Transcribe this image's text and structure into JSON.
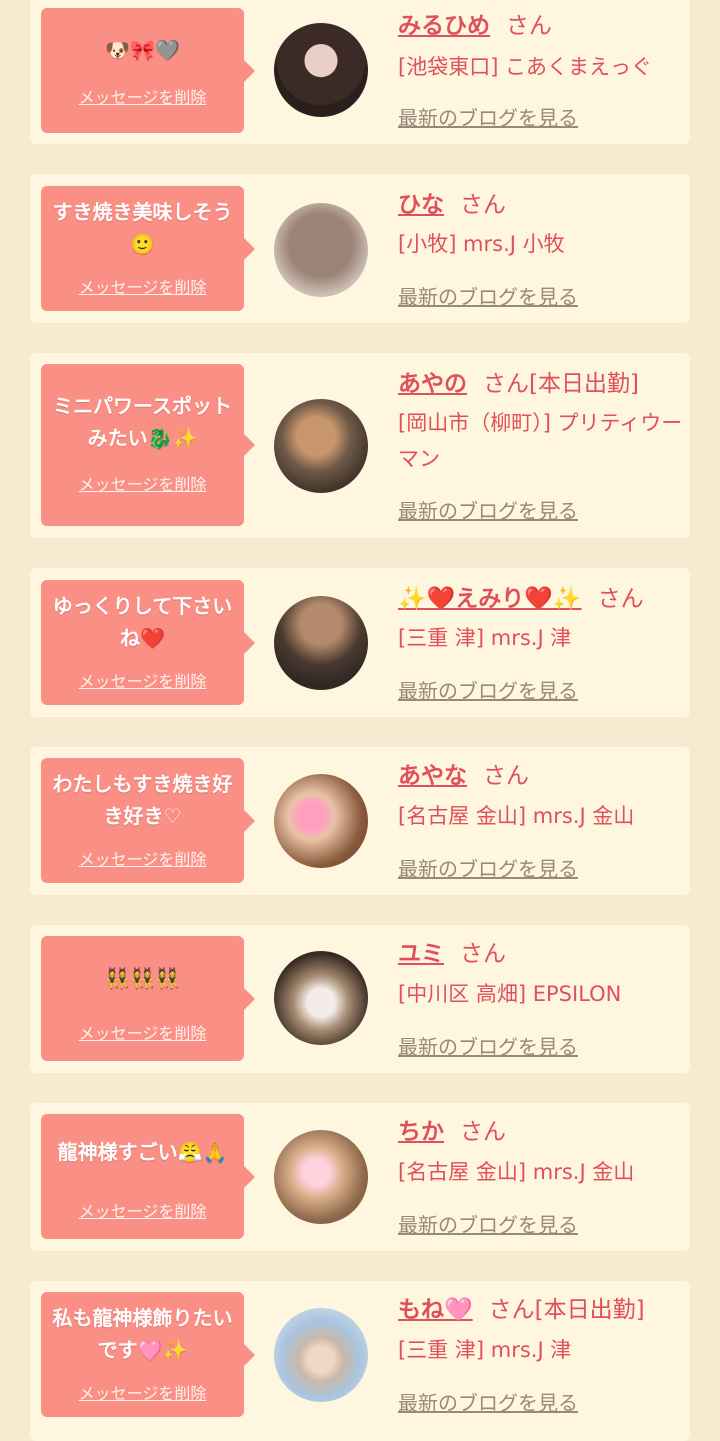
{
  "delete_label": "メッセージを削除",
  "blog_label": "最新のブログを見る",
  "suffix": "さん",
  "entries": [
    {
      "message": "🐶🎀🩶",
      "name": "みるひめ",
      "status": "",
      "shop": "[池袋東口] こあくまえっぐ"
    },
    {
      "message": "すき焼き美味しそう🙂",
      "name": "ひな",
      "status": "",
      "shop": "[小牧] mrs.J 小牧"
    },
    {
      "message": "ミニパワースポットみたい🐉✨",
      "name": "あやの",
      "status": "[本日出勤]",
      "shop": "[岡山市（柳町）] プリティウーマン"
    },
    {
      "message": "ゆっくりして下さいね❤️",
      "name": "✨❤️えみり❤️✨",
      "status": "",
      "shop": "[三重 津] mrs.J 津"
    },
    {
      "message": "わたしもすき焼き好き好き♡",
      "name": "あやな",
      "status": "",
      "shop": "[名古屋 金山] mrs.J 金山"
    },
    {
      "message": "👯👯👯",
      "name": "ユミ",
      "status": "",
      "shop": "[中川区 高畑] EPSILON"
    },
    {
      "message": "龍神様すごい😤🙏",
      "name": "ちか",
      "status": "",
      "shop": "[名古屋 金山] mrs.J 金山"
    },
    {
      "message": "私も龍神様飾りたいです🩷✨",
      "name": "もね🩷",
      "status": "[本日出勤]",
      "shop": "[三重 津] mrs.J 津"
    }
  ]
}
